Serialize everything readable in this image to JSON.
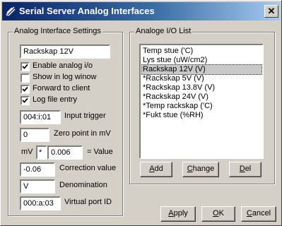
{
  "window": {
    "title": "Serial Server Analog Interfaces"
  },
  "settings": {
    "group_title": "Analog Interface Settings",
    "name_value": "Rackskap 12V",
    "checkboxes": [
      {
        "label": "Enable analog i/o",
        "checked": true
      },
      {
        "label": "Show in log winow",
        "checked": false
      },
      {
        "label": "Forward to client",
        "checked": true
      },
      {
        "label": "Log file entry",
        "checked": true
      }
    ],
    "input_trigger_value": "004:i:01",
    "input_trigger_label": "Input trigger",
    "zero_point_value": "0",
    "zero_point_label": "Zero point in mV",
    "mv_label": "mV",
    "operator_value": "*",
    "multiplier_value": "0.006",
    "equals_value_label": "= Value",
    "correction_value": "-0.06",
    "correction_label": "Correction value",
    "denomination_value": "V",
    "denomination_label": "Denomination",
    "virtual_port_value": "000:a:03",
    "virtual_port_label": "Virtual port ID"
  },
  "io_list": {
    "group_title": "Analoge I/O List",
    "items": [
      "Temp stue ('C)",
      "Lys stue (uW/cm2)",
      "Rackskap 12V (V)",
      "*Rackskap 5V (V)",
      "*Rackskap 13.8V (V)",
      "*Rackskap 24V (V)",
      "*Temp rackskap ('C)",
      "*Fukt stue (%RH)"
    ],
    "selected_index": 2,
    "add_label_u": "A",
    "add_label_rest": "dd",
    "change_label_u": "C",
    "change_label_rest": "hange",
    "del_label_u": "D",
    "del_label_rest": "el"
  },
  "footer": {
    "apply_u": "A",
    "apply_rest": "pply",
    "ok_u": "O",
    "ok_rest": "K",
    "cancel_u": "C",
    "cancel_rest": "ancel"
  },
  "colors": {
    "title_start": "#0a246a",
    "title_end": "#a6caf0",
    "face": "#d4d0c8"
  }
}
